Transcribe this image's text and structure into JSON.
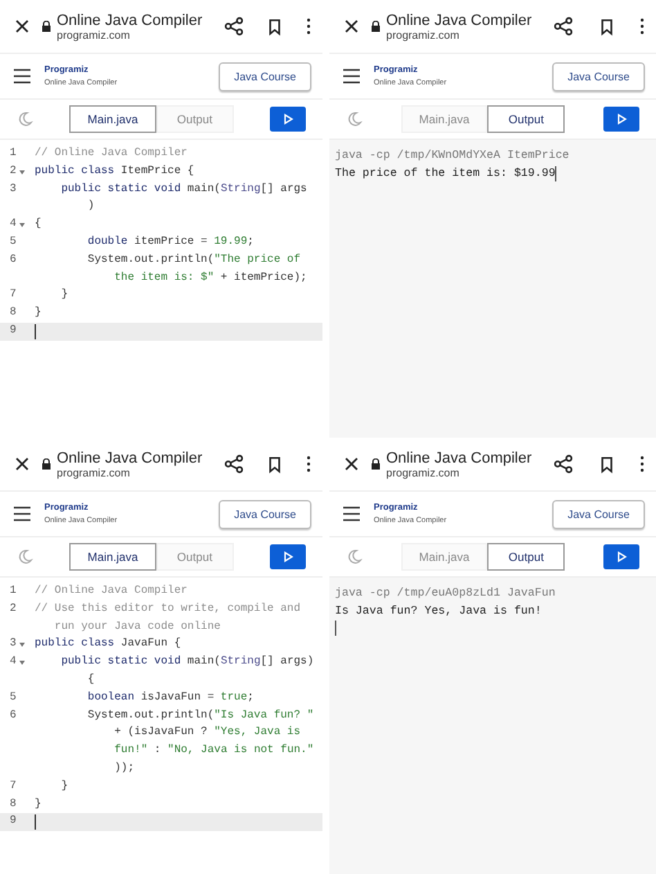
{
  "panels": [
    {
      "browser": {
        "title": "Online Java Compiler",
        "url": "programiz.com"
      },
      "header": {
        "logo": "Programiz",
        "subtitle": "Online Java Compiler",
        "button": "Java Course"
      },
      "tabs": [
        {
          "label": "Main.java",
          "selected": true
        },
        {
          "label": "Output",
          "selected": false
        }
      ],
      "kind": "editor",
      "code": [
        {
          "number": "1",
          "foldable": false,
          "selected": false,
          "rows": [
            {
              "tokens": [
                {
                  "kind": "comment",
                  "text": "// Online Java Compiler"
                }
              ]
            }
          ]
        },
        {
          "number": "2",
          "foldable": true,
          "selected": false,
          "rows": [
            {
              "tokens": [
                {
                  "kind": "keyword",
                  "text": "public class "
                },
                {
                  "kind": "plain",
                  "text": "ItemPrice {"
                }
              ]
            }
          ]
        },
        {
          "number": "3",
          "foldable": false,
          "selected": false,
          "rows": [
            {
              "tokens": [
                {
                  "kind": "keyword",
                  "text": "    public static void "
                },
                {
                  "kind": "plain",
                  "text": "main("
                },
                {
                  "kind": "type",
                  "text": "String"
                },
                {
                  "kind": "plain",
                  "text": "[] args"
                }
              ]
            },
            {
              "tokens": [
                {
                  "kind": "plain",
                  "text": "        )"
                }
              ]
            }
          ]
        },
        {
          "number": "4",
          "foldable": true,
          "selected": false,
          "rows": [
            {
              "tokens": [
                {
                  "kind": "plain",
                  "text": "{"
                }
              ]
            }
          ]
        },
        {
          "number": "5",
          "foldable": false,
          "selected": false,
          "rows": [
            {
              "tokens": [
                {
                  "kind": "keyword",
                  "text": "        double "
                },
                {
                  "kind": "plain",
                  "text": "itemPrice = "
                },
                {
                  "kind": "number",
                  "text": "19.99"
                },
                {
                  "kind": "plain",
                  "text": ";"
                }
              ]
            }
          ]
        },
        {
          "number": "6",
          "foldable": false,
          "selected": false,
          "rows": [
            {
              "tokens": [
                {
                  "kind": "plain",
                  "text": "        System.out.println("
                },
                {
                  "kind": "string",
                  "text": "\"The price of"
                }
              ]
            },
            {
              "tokens": [
                {
                  "kind": "string",
                  "text": "            the item is: $\""
                },
                {
                  "kind": "plain",
                  "text": " + itemPrice);"
                }
              ]
            }
          ]
        },
        {
          "number": "7",
          "foldable": false,
          "selected": false,
          "rows": [
            {
              "tokens": [
                {
                  "kind": "plain",
                  "text": "    }"
                }
              ]
            }
          ]
        },
        {
          "number": "8",
          "foldable": false,
          "selected": false,
          "rows": [
            {
              "tokens": [
                {
                  "kind": "plain",
                  "text": "}"
                }
              ]
            }
          ]
        },
        {
          "number": "9",
          "foldable": false,
          "selected": true
        }
      ]
    },
    {
      "browser": {
        "title": "Online Java Compiler",
        "url": "programiz.com"
      },
      "header": {
        "logo": "Programiz",
        "subtitle": "Online Java Compiler",
        "button": "Java Course"
      },
      "tabs": [
        {
          "label": "Main.java",
          "selected": false
        },
        {
          "label": "Output",
          "selected": true
        }
      ],
      "kind": "output",
      "output": [
        {
          "kind": "command",
          "text": "java -cp /tmp/KWnOMdYXeA ItemPrice"
        },
        {
          "kind": "result",
          "text": "The price of the item is: $19.99"
        }
      ],
      "cursor_on_new_line": false
    },
    {
      "browser": {
        "title": "Online Java Compiler",
        "url": "programiz.com"
      },
      "header": {
        "logo": "Programiz",
        "subtitle": "Online Java Compiler",
        "button": "Java Course"
      },
      "tabs": [
        {
          "label": "Main.java",
          "selected": true
        },
        {
          "label": "Output",
          "selected": false
        }
      ],
      "kind": "editor",
      "code": [
        {
          "number": "1",
          "foldable": false,
          "selected": false,
          "rows": [
            {
              "tokens": [
                {
                  "kind": "comment",
                  "text": "// Online Java Compiler"
                }
              ]
            }
          ]
        },
        {
          "number": "2",
          "foldable": false,
          "selected": false,
          "rows": [
            {
              "tokens": [
                {
                  "kind": "comment",
                  "text": "// Use this editor to write, compile and"
                }
              ]
            },
            {
              "tokens": [
                {
                  "kind": "comment",
                  "text": "   run your Java code online"
                }
              ]
            }
          ]
        },
        {
          "number": "3",
          "foldable": true,
          "selected": false,
          "rows": [
            {
              "tokens": [
                {
                  "kind": "keyword",
                  "text": "public class "
                },
                {
                  "kind": "plain",
                  "text": "JavaFun {"
                }
              ]
            }
          ]
        },
        {
          "number": "4",
          "foldable": true,
          "selected": false,
          "rows": [
            {
              "tokens": [
                {
                  "kind": "keyword",
                  "text": "    public static void "
                },
                {
                  "kind": "plain",
                  "text": "main("
                },
                {
                  "kind": "type",
                  "text": "String"
                },
                {
                  "kind": "plain",
                  "text": "[] args)"
                }
              ]
            },
            {
              "tokens": [
                {
                  "kind": "plain",
                  "text": "        {"
                }
              ]
            }
          ]
        },
        {
          "number": "5",
          "foldable": false,
          "selected": false,
          "rows": [
            {
              "tokens": [
                {
                  "kind": "keyword",
                  "text": "        boolean "
                },
                {
                  "kind": "plain",
                  "text": "isJavaFun = "
                },
                {
                  "kind": "number",
                  "text": "true"
                },
                {
                  "kind": "plain",
                  "text": ";"
                }
              ]
            }
          ]
        },
        {
          "number": "6",
          "foldable": false,
          "selected": false,
          "rows": [
            {
              "tokens": [
                {
                  "kind": "plain",
                  "text": "        System.out.println("
                },
                {
                  "kind": "string",
                  "text": "\"Is Java fun? \""
                }
              ]
            },
            {
              "tokens": [
                {
                  "kind": "plain",
                  "text": "            + (isJavaFun ? "
                },
                {
                  "kind": "string",
                  "text": "\"Yes, Java is"
                }
              ]
            },
            {
              "tokens": [
                {
                  "kind": "string",
                  "text": "            fun!\""
                },
                {
                  "kind": "plain",
                  "text": " : "
                },
                {
                  "kind": "string",
                  "text": "\"No, Java is not fun.\""
                }
              ]
            },
            {
              "tokens": [
                {
                  "kind": "plain",
                  "text": "            ));"
                }
              ]
            }
          ]
        },
        {
          "number": "7",
          "foldable": false,
          "selected": false,
          "rows": [
            {
              "tokens": [
                {
                  "kind": "plain",
                  "text": "    }"
                }
              ]
            }
          ]
        },
        {
          "number": "8",
          "foldable": false,
          "selected": false,
          "rows": [
            {
              "tokens": [
                {
                  "kind": "plain",
                  "text": "}"
                }
              ]
            }
          ]
        },
        {
          "number": "9",
          "foldable": false,
          "selected": true
        }
      ]
    },
    {
      "browser": {
        "title": "Online Java Compiler",
        "url": "programiz.com"
      },
      "header": {
        "logo": "Programiz",
        "subtitle": "Online Java Compiler",
        "button": "Java Course"
      },
      "tabs": [
        {
          "label": "Main.java",
          "selected": false
        },
        {
          "label": "Output",
          "selected": true
        }
      ],
      "kind": "output",
      "output": [
        {
          "kind": "command",
          "text": "java -cp /tmp/euA0p8zLd1 JavaFun"
        },
        {
          "kind": "result",
          "text": "Is Java fun? Yes, Java is fun!"
        }
      ],
      "cursor_on_new_line": true
    }
  ]
}
